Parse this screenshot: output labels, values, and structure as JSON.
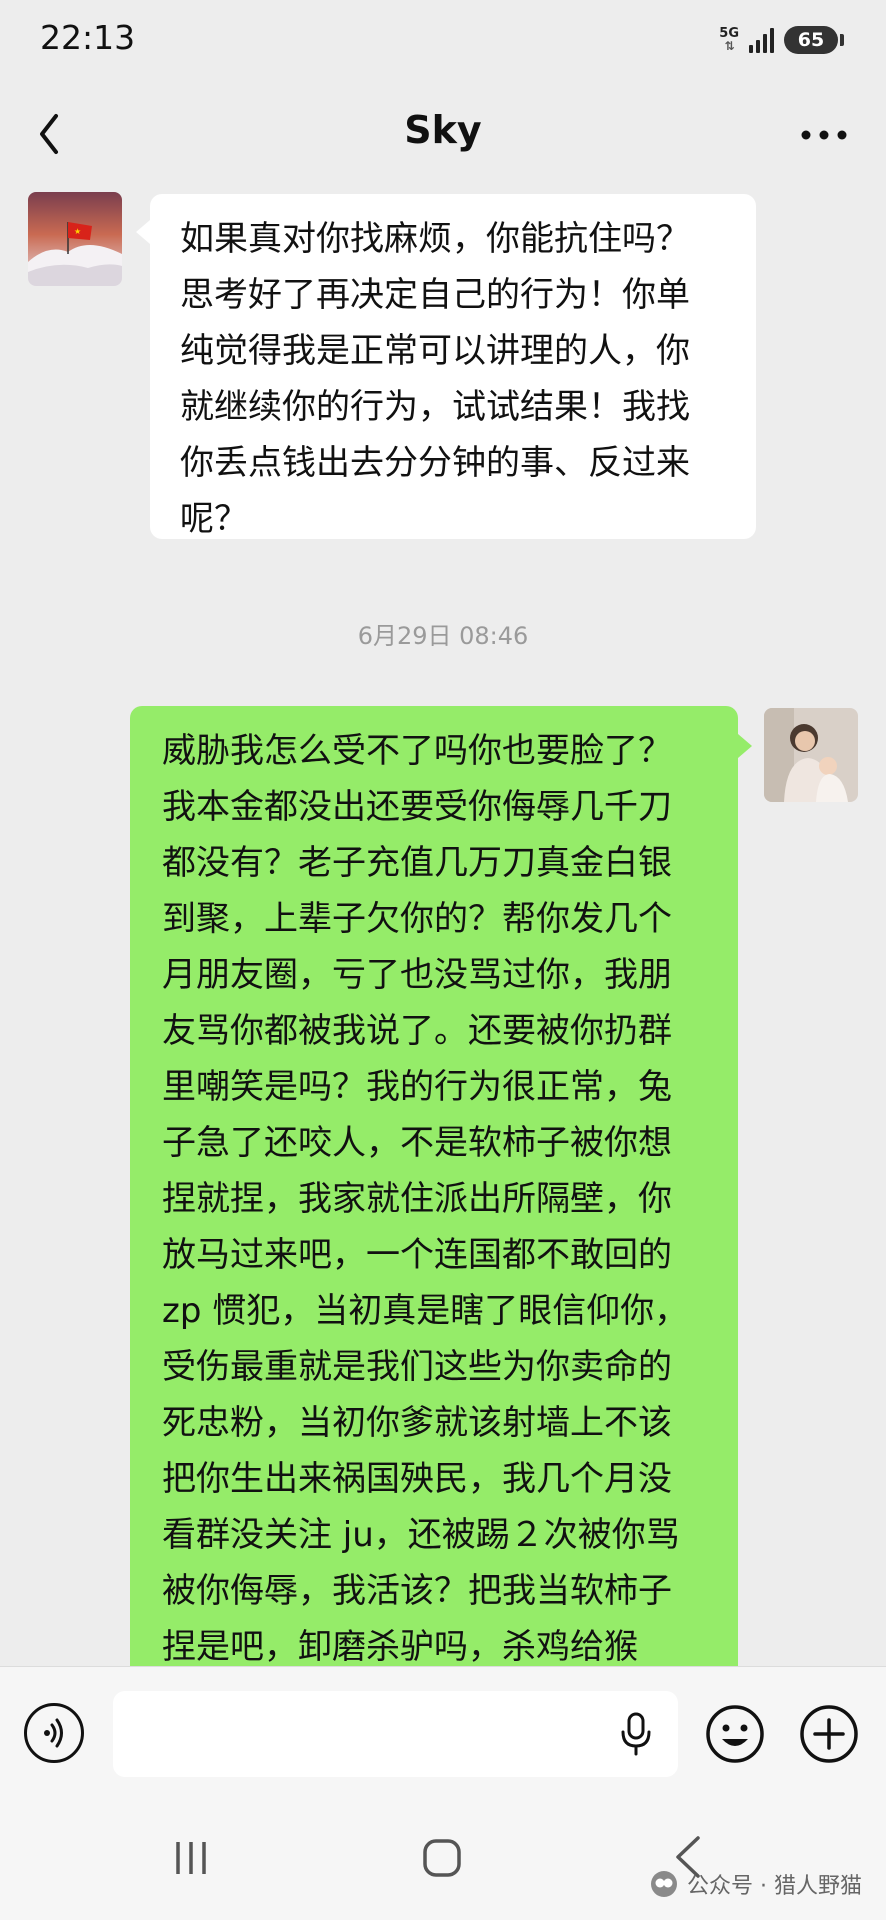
{
  "status_bar": {
    "time": "22:13",
    "network": "5G",
    "battery": "65"
  },
  "header": {
    "title": "Sky",
    "back_icon": "chevron-left-icon",
    "more_icon": "more-dots-icon"
  },
  "messages": {
    "incoming": {
      "text": "如果真对你找麻烦，你能抗住吗？\n思考好了再决定自己的行为！你单\n纯觉得我是正常可以讲理的人，你\n就继续你的行为，试试结果！我找\n你丢点钱出去分分钟的事、反过来\n呢？"
    },
    "timestamp": "6月29日 08:46",
    "outgoing": {
      "text": "威胁我怎么受不了吗你也要脸了？\n我本金都没出还要受你侮辱几千刀\n都没有？老子充值几万刀真金白银\n到聚，上辈子欠你的？帮你发几个\n月朋友圈，亏了也没骂过你，我朋\n友骂你都被我说了。还要被你扔群\n里嘲笑是吗？我的行为很正常，兔\n子急了还咬人，不是软柿子被你想\n捏就捏，我家就住派出所隔壁，你\n放马过来吧，一个连国都不敢回的\nzp 惯犯，当初真是瞎了眼信仰你，\n受伤最重就是我们这些为你卖命的\n死忠粉，当初你爹就该射墙上不该\n把你生出来祸国殃民，我几个月没\n看群没关注 ju，还被踢２次被你骂\n被你侮辱，我活该？把我当软柿子\n捏是吧，卸磨杀驴吗，杀鸡给猴\n看？"
    }
  },
  "input_bar": {
    "placeholder": "",
    "voice_icon": "voice-icon",
    "mic_icon": "microphone-icon",
    "emoji_icon": "emoji-icon",
    "plus_icon": "plus-icon"
  },
  "watermark": {
    "text": "公众号 · 猎人野猫"
  },
  "colors": {
    "background": "#ededed",
    "outgoing_bubble": "#95ec69",
    "incoming_bubble": "#ffffff"
  }
}
